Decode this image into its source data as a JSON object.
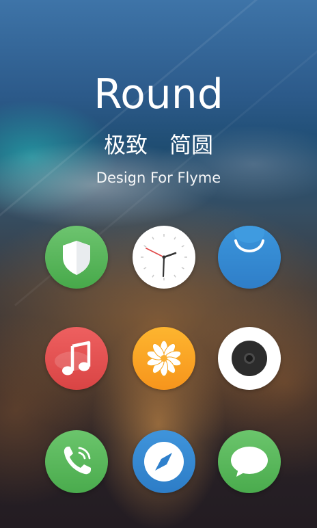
{
  "header": {
    "title": "Round",
    "subtitle": "极致　简圆",
    "tagline": "Design For Flyme"
  },
  "icons": [
    {
      "name": "security-icon",
      "color": "#4caf50"
    },
    {
      "name": "clock-icon",
      "color": "#ffffff"
    },
    {
      "name": "app-store-icon",
      "color": "#3a8fd8"
    },
    {
      "name": "music-icon",
      "color": "#e55050"
    },
    {
      "name": "gallery-icon",
      "color": "#f9a825"
    },
    {
      "name": "camera-icon",
      "color": "#ffffff"
    },
    {
      "name": "phone-icon",
      "color": "#4caf50"
    },
    {
      "name": "browser-icon",
      "color": "#3a8fd8"
    },
    {
      "name": "message-icon",
      "color": "#4caf50"
    }
  ]
}
